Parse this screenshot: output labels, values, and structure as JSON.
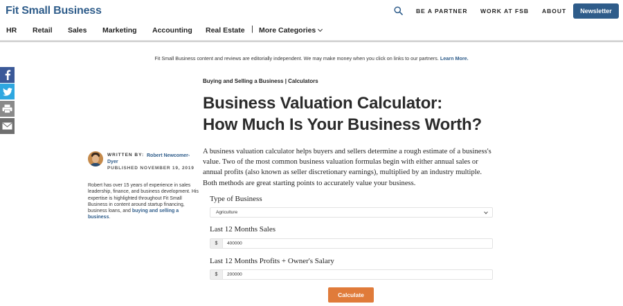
{
  "header": {
    "logo": "Fit Small Business",
    "links": [
      "BE A PARTNER",
      "WORK AT FSB",
      "ABOUT"
    ],
    "newsletter_label": "Newsletter"
  },
  "nav": {
    "categories": [
      "HR",
      "Retail",
      "Sales",
      "Marketing",
      "Accounting",
      "Real Estate"
    ],
    "separator": "|",
    "more_label": "More Categories"
  },
  "disclosure": {
    "text": "Fit Small Business content and reviews are editorially independent. We may make money when you click on links to our partners. ",
    "link": "Learn More."
  },
  "social": [
    "facebook-icon",
    "twitter-icon",
    "print-icon",
    "email-icon"
  ],
  "article": {
    "kicker": "Buying and Selling a Business | Calculators",
    "title_line1": "Business Valuation Calculator:",
    "title_line2": "How Much Is Your Business Worth?",
    "intro": "A business valuation calculator helps buyers and sellers determine a rough estimate of a business's value. Two of the most common business valuation formulas begin with either annual sales or annual profits (also known as seller discretionary earnings), multiplied by an industry multiple. Both methods are great starting points to accurately value your business."
  },
  "author": {
    "written_by": "WRITTEN BY:",
    "name": "Robert Newcomer-Dyer",
    "published": "PUBLISHED NOVEMBER 19, 2019",
    "bio": "Robert has over 15 years of experience in sales leadership, finance, and business development. His expertise is highlighted throughout Fit Small Business in content around startup financing, business loans, and ",
    "bio_link": "buying and selling a business",
    "bio_end": "."
  },
  "calculator": {
    "type_label": "Type of Business",
    "type_value": "Agriculture",
    "sales_label": "Last 12 Months Sales",
    "currency": "$",
    "sales_value": "400000",
    "profit_label": "Last 12 Months Profits + Owner's Salary",
    "profit_value": "200000",
    "button": "Calculate"
  }
}
